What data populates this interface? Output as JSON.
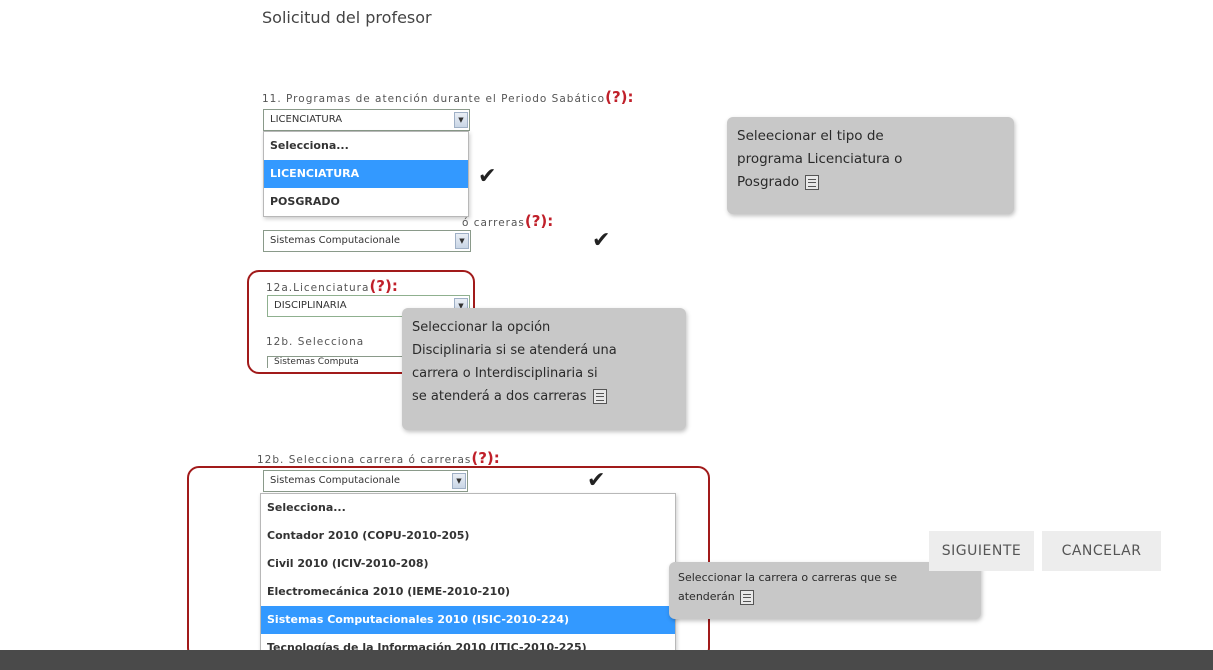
{
  "page_title": "Solicitud del profesor",
  "q11": {
    "label": "11. Programas de atención durante el Periodo Sabático",
    "help": "(?):",
    "value": "LICENCIATURA",
    "options": [
      "Selecciona...",
      "LICENCIATURA",
      "POSGRADO"
    ],
    "selected_option": "LICENCIATURA"
  },
  "q12": {
    "label_tail": "ó carreras",
    "help": "(?):",
    "value": "Sistemas Computacionale"
  },
  "q12a": {
    "label": "12a.Licenciatura",
    "help": "(?):",
    "value": "DISCIPLINARIA"
  },
  "q12b_partial": {
    "label": "12b. Selecciona",
    "value": "Sistemas Computa"
  },
  "q12b": {
    "label": "12b. Selecciona carrera ó carreras",
    "help": "(?):",
    "value": "Sistemas Computacionale",
    "options": [
      "Selecciona...",
      "Contador 2010 (COPU-2010-205)",
      "Civil 2010 (ICIV-2010-208)",
      "Electromecánica 2010 (IEME-2010-210)",
      "Sistemas Computacionales 2010 (ISIC-2010-224)",
      "Tecnologías de la Información 2010 (ITIC-2010-225)"
    ],
    "selected_option": "Sistemas Computacionales 2010 (ISIC-2010-224)"
  },
  "tooltips": {
    "programa": [
      "Seleecionar el tipo de",
      "programa Licenciatura o",
      "Posgrado"
    ],
    "licenciatura": [
      "Seleccionar la opción",
      "Disciplinaria si se atenderá una",
      "carrera o Interdisciplinaria si",
      "se atenderá a dos carreras"
    ],
    "carreras": [
      "Seleccionar la carrera o carreras que se",
      "atenderán"
    ]
  },
  "buttons": {
    "next": "SIGUIENTE",
    "cancel": "CANCELAR"
  },
  "icons": {
    "check": "checkmark-icon",
    "arrow": "chevron-down-icon",
    "tooltip": "list-icon"
  },
  "colors": {
    "help": "#c0202a",
    "highlight_border": "#a11a1a",
    "selected_option": "#3399ff",
    "tooltip_bg": "#c8c8c8",
    "footer": "#4a4a4a"
  }
}
